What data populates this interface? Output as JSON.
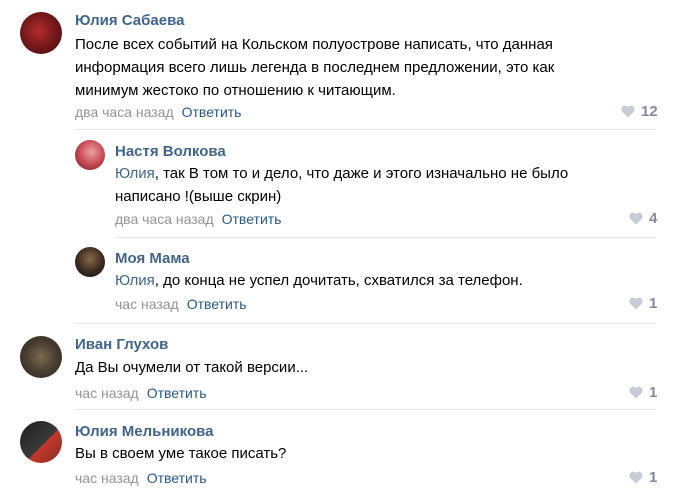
{
  "comments": [
    {
      "author": "Юлия Сабаева",
      "text": "После всех событий на Кольском полуострове написать, что данная информация всего лишь легенда в последнем предложении, это как минимум жестоко по отношению к читающим.",
      "time": "два часа назад",
      "reply_label": "Ответить",
      "likes": "12",
      "avatar_colors": [
        "#5a0f12",
        "#b52d2d"
      ]
    },
    {
      "author": "Настя Волкова",
      "mention": "Юлия",
      "text": ", так В том то и дело, что даже и этого изначально не было написано !(выше скрин)",
      "time": "два часа назад",
      "reply_label": "Ответить",
      "likes": "4",
      "avatar_colors": [
        "#c94a55",
        "#e9a2a2"
      ]
    },
    {
      "author": "Моя Мама",
      "mention": "Юлия",
      "text": ", до конца не успел дочитать, схватился за телефон.",
      "time": "час назад",
      "reply_label": "Ответить",
      "likes": "1",
      "avatar_colors": [
        "#1a1a1a",
        "#8a6a4a"
      ]
    },
    {
      "author": "Иван Глухов",
      "text": "Да Вы очумели от такой версии...",
      "time": "час назад",
      "reply_label": "Ответить",
      "likes": "1",
      "avatar_colors": [
        "#3a3228",
        "#7a6a52"
      ]
    },
    {
      "author": "Юлия Мельникова",
      "text": "Вы в своем уме такое писать?",
      "time": "час назад",
      "reply_label": "Ответить",
      "likes": "1",
      "avatar_colors": [
        "#2b2b2b",
        "#c0392b"
      ]
    }
  ],
  "icons": {
    "like": "heart-icon"
  },
  "colors": {
    "link": "#42648b",
    "meta": "#939393",
    "like": "#828a99",
    "divider": "#e7e8ec"
  }
}
